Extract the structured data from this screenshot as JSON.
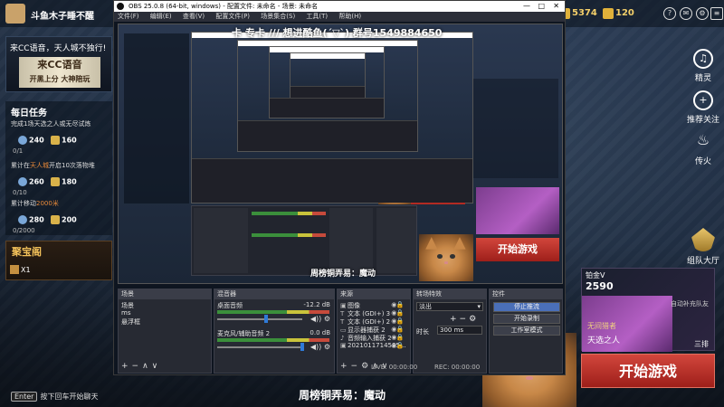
{
  "game": {
    "title": "斗鱼木子睡不醒",
    "coins": "5374",
    "gold": "120",
    "left_banner": {
      "text1": "来CC语音，天人城不独行!",
      "text2": "来CC语音",
      "text3": "开黑上分 大神陪玩"
    },
    "tasks": {
      "header": "每日任务",
      "items": [
        {
          "pre": "完成1场天选之人或无尽试炼",
          "hl": "",
          "post": "",
          "progress": "0/1",
          "r1": "240",
          "r2": "160"
        },
        {
          "pre": "累计在",
          "hl": "天人城",
          "post": "开启10次落物堆",
          "progress": "0/10",
          "r1": "260",
          "r2": "180"
        },
        {
          "pre": "累计移动",
          "hl": "2000米",
          "post": "",
          "progress": "0/2000",
          "r1": "280",
          "r2": "200"
        }
      ]
    },
    "jubaoge": {
      "title": "聚宝阁",
      "count": "X1"
    },
    "enter_hint": {
      "key": "Enter",
      "text": "按下回车开始聊天"
    },
    "right_sidebar": [
      {
        "label": "精灵",
        "icon": "headset-icon"
      },
      {
        "label": "推荐关注",
        "icon": "add-user-icon"
      },
      {
        "label": "传火",
        "icon": "fire-icon"
      }
    ],
    "team_hall": "组队大厅",
    "rank": {
      "level": "铂金V",
      "points": "2590",
      "side_text": "自动补充队友",
      "hero_title": "无间猎者",
      "hero_name": "天选之人",
      "mode": "三排"
    },
    "start_button": "开始游戏"
  },
  "obs": {
    "title": "OBS 25.0.8 (64-bit, windows) - 配置文件: 未命名 - 场景: 未命名",
    "menu": [
      "文件(F)",
      "编辑(E)",
      "查看(V)",
      "配置文件(P)",
      "场景集合(S)",
      "工具(T)",
      "帮助(H)"
    ],
    "win_controls": [
      "—",
      "□",
      "✕"
    ],
    "overlay_banner": "卡 专卡 /// 想进酷鱼(´▽`) 群号1549884650",
    "overlay_tip": "周榜铜弄易：魔动",
    "docks": {
      "scenes": {
        "header": "场景",
        "items": [
          "场景",
          "ms",
          "悬浮框"
        ]
      },
      "mixer": {
        "header": "混音器",
        "channels": [
          {
            "name": "桌面音频",
            "db": "-12.2 dB"
          },
          {
            "name": "麦克风/辅助音频 2",
            "db": "0.0 dB"
          }
        ]
      },
      "sources": {
        "header": "来源",
        "items": [
          {
            "icon": "image-icon",
            "label": "图像"
          },
          {
            "icon": "text-icon",
            "label": "文本 (GDI+) 3"
          },
          {
            "icon": "text-icon",
            "label": "文本 (GDI+) 2"
          },
          {
            "icon": "display-icon",
            "label": "显示器捕获 2"
          },
          {
            "icon": "audio-icon",
            "label": "音频输入捕获 2"
          },
          {
            "icon": "image-icon",
            "label": "2021011714585..."
          }
        ]
      },
      "transitions": {
        "header": "转场特效",
        "select": "淡出",
        "duration_label": "时长",
        "duration": "300 ms"
      },
      "controls": {
        "header": "控件",
        "buttons": [
          "停止推流",
          "开始录制",
          "工作室模式"
        ]
      }
    },
    "status": {
      "live": "LIVE: 00:00:00",
      "rec": "REC: 00:00:00"
    }
  },
  "bottom_caption": "周榜铜弄易：魔动"
}
